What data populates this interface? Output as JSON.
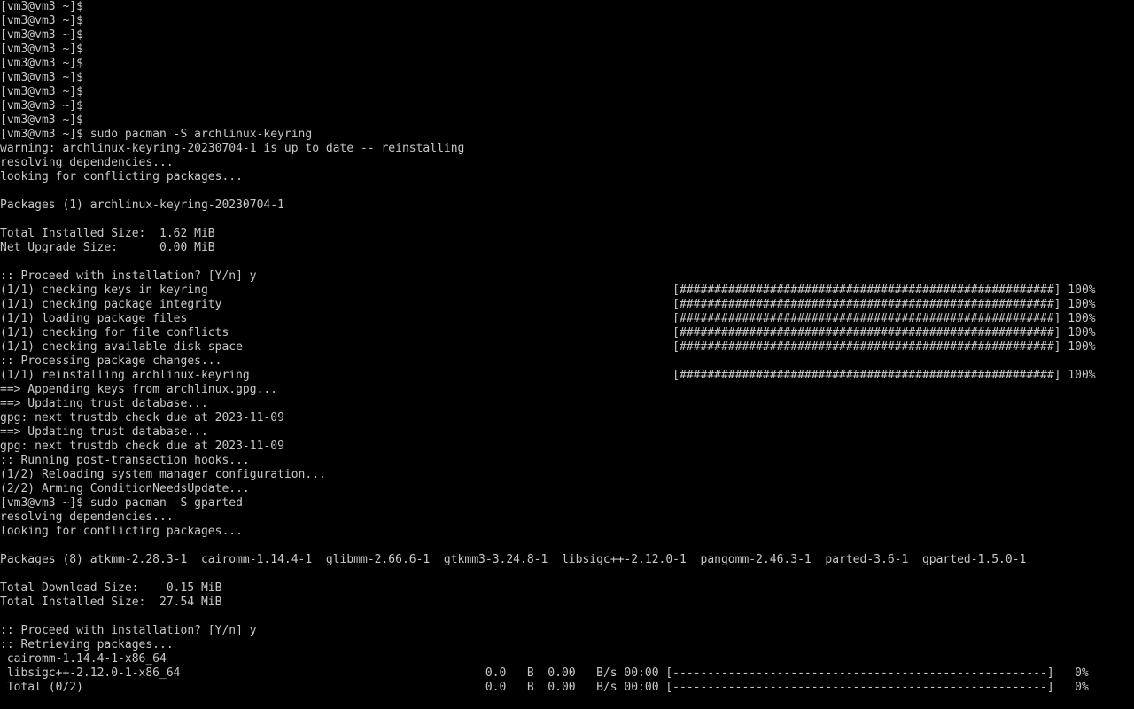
{
  "terminal": {
    "lines": [
      "[vm3@vm3 ~]$",
      "[vm3@vm3 ~]$",
      "[vm3@vm3 ~]$",
      "[vm3@vm3 ~]$",
      "[vm3@vm3 ~]$",
      "[vm3@vm3 ~]$",
      "[vm3@vm3 ~]$",
      "[vm3@vm3 ~]$",
      "[vm3@vm3 ~]$",
      "[vm3@vm3 ~]$ sudo pacman -S archlinux-keyring",
      "warning: archlinux-keyring-20230704-1 is up to date -- reinstalling",
      "resolving dependencies...",
      "looking for conflicting packages...",
      "",
      "Packages (1) archlinux-keyring-20230704-1",
      "",
      "Total Installed Size:  1.62 MiB",
      "Net Upgrade Size:      0.00 MiB",
      "",
      ":: Proceed with installation? [Y/n] y",
      "(1/1) checking keys in keyring                                                                   [######################################################] 100%",
      "(1/1) checking package integrity                                                                 [######################################################] 100%",
      "(1/1) loading package files                                                                      [######################################################] 100%",
      "(1/1) checking for file conflicts                                                                [######################################################] 100%",
      "(1/1) checking available disk space                                                              [######################################################] 100%",
      ":: Processing package changes...",
      "(1/1) reinstalling archlinux-keyring                                                             [######################################################] 100%",
      "==> Appending keys from archlinux.gpg...",
      "==> Updating trust database...",
      "gpg: next trustdb check due at 2023-11-09",
      "==> Updating trust database...",
      "gpg: next trustdb check due at 2023-11-09",
      ":: Running post-transaction hooks...",
      "(1/2) Reloading system manager configuration...",
      "(2/2) Arming ConditionNeedsUpdate...",
      "[vm3@vm3 ~]$ sudo pacman -S gparted",
      "resolving dependencies...",
      "looking for conflicting packages...",
      "",
      "Packages (8) atkmm-2.28.3-1  cairomm-1.14.4-1  glibmm-2.66.6-1  gtkmm3-3.24.8-1  libsigc++-2.12.0-1  pangomm-2.46.3-1  parted-3.6-1  gparted-1.5.0-1",
      "",
      "Total Download Size:    0.15 MiB",
      "Total Installed Size:  27.54 MiB",
      "",
      ":: Proceed with installation? [Y/n] y",
      ":: Retrieving packages...",
      " cairomm-1.14.4-1-x86_64",
      " libsigc++-2.12.0-1-x86_64                                            0.0   B  0.00   B/s 00:00 [------------------------------------------------------]   0%",
      " Total (0/2)                                                          0.0   B  0.00   B/s 00:00 [------------------------------------------------------]   0%"
    ]
  }
}
